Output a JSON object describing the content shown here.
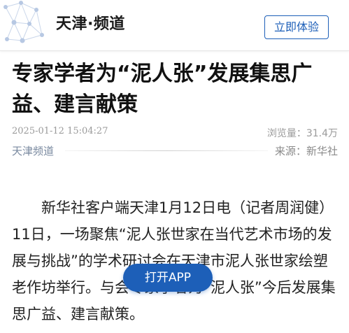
{
  "header": {
    "site_title": "天津·频道",
    "open_button_label": "立即体验"
  },
  "article": {
    "title": "专家学者为“泥人张”发展集思广益、建言献策",
    "date": "2025-01-12 15:04:27",
    "views": "浏览量：31.4万",
    "channel": "天津频道",
    "source": "来源：新华社",
    "body": "新华社客户端天津1月12日电（记者周润健）11日，一场聚焦“泥人张世家在当代艺术市场的发展与挑战”的学术研讨会在天津市泥人张世家绘塑老作坊举行。与会专家学者为“泥人张”今后发展集思广益、建言献策。"
  },
  "floating": {
    "app_button_label": "打开APP"
  },
  "colors": {
    "brand_blue": "#1d5fb8",
    "meta_gray": "#9a9a9a",
    "title_black": "#111111"
  }
}
